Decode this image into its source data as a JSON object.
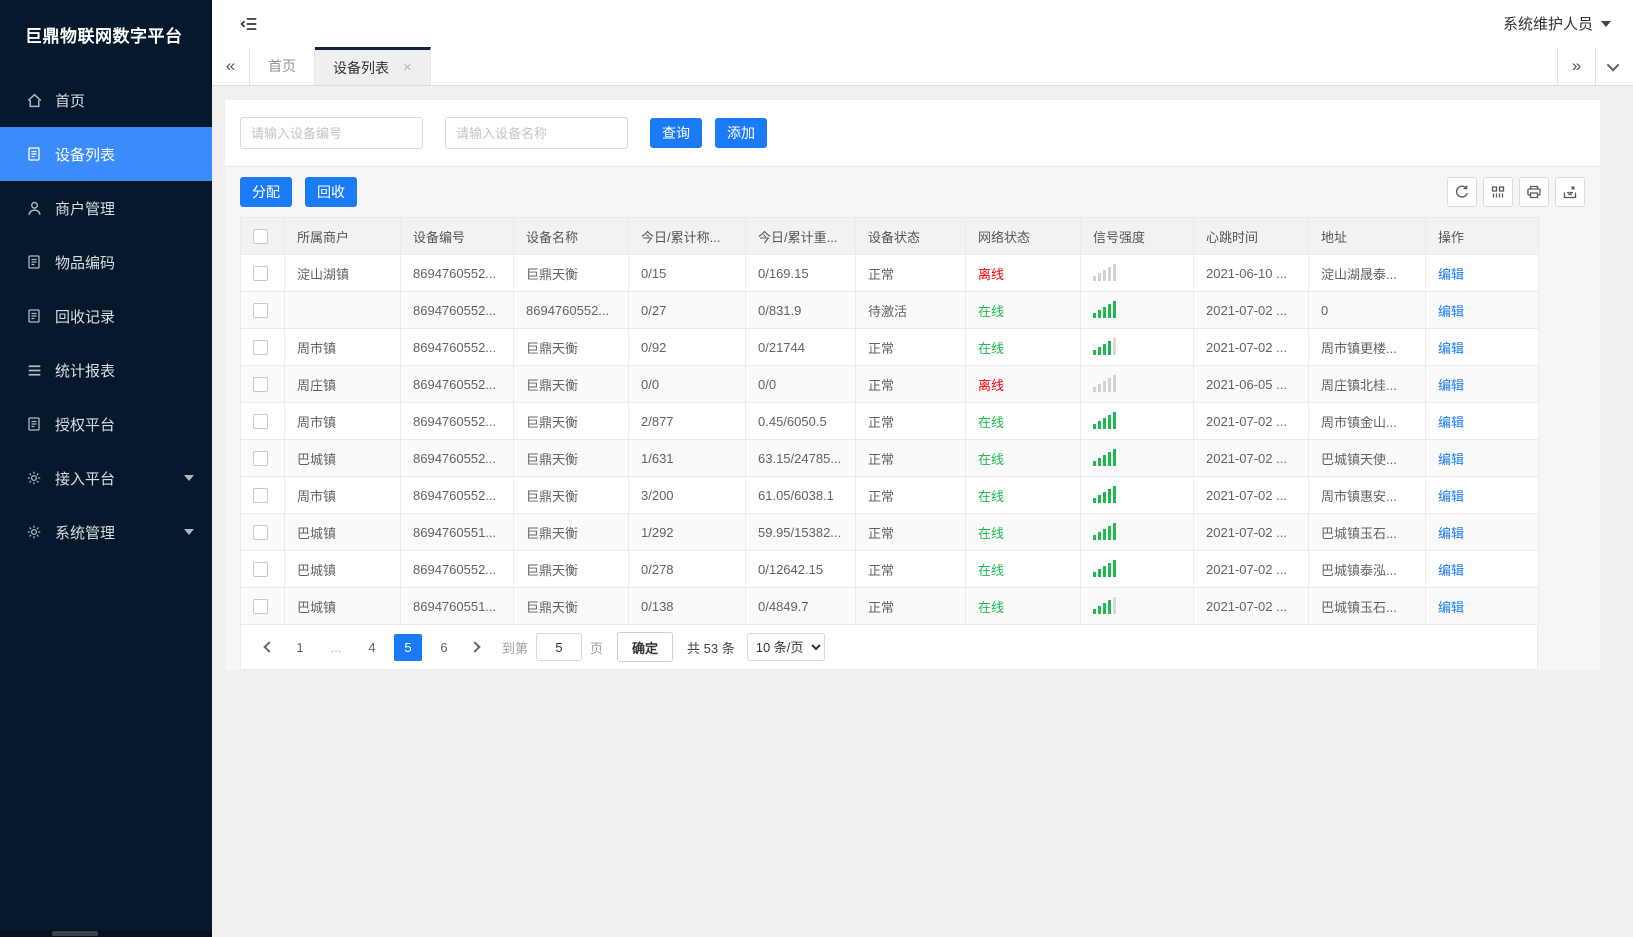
{
  "app": {
    "title": "巨鼎物联网数字平台",
    "user_menu": "系统维护人员"
  },
  "colors": {
    "accent": "#1b7bf7",
    "sidebar_bg": "#06182c",
    "sidebar_active": "#3b8cfa",
    "online_green": "#1cba50",
    "offline_red": "#f40000"
  },
  "sidebar": {
    "items": [
      {
        "label": "首页",
        "icon": "home",
        "active": false,
        "expandable": false
      },
      {
        "label": "设备列表",
        "icon": "doc",
        "active": true,
        "expandable": false
      },
      {
        "label": "商户管理",
        "icon": "user",
        "active": false,
        "expandable": false
      },
      {
        "label": "物品编码",
        "icon": "doc",
        "active": false,
        "expandable": false
      },
      {
        "label": "回收记录",
        "icon": "doc",
        "active": false,
        "expandable": false
      },
      {
        "label": "统计报表",
        "icon": "lines",
        "active": false,
        "expandable": false
      },
      {
        "label": "授权平台",
        "icon": "doc",
        "active": false,
        "expandable": false
      },
      {
        "label": "接入平台",
        "icon": "gear",
        "active": false,
        "expandable": true
      },
      {
        "label": "系统管理",
        "icon": "gear",
        "active": false,
        "expandable": true
      }
    ]
  },
  "tabbar": {
    "tabs": [
      {
        "label": "首页",
        "active": false,
        "closable": false
      },
      {
        "label": "设备列表",
        "active": true,
        "closable": true
      }
    ]
  },
  "search": {
    "device_no_placeholder": "请输入设备编号",
    "device_name_placeholder": "请输入设备名称",
    "query_label": "查询",
    "add_label": "添加"
  },
  "toolbar": {
    "assign_label": "分配",
    "recycle_label": "回收"
  },
  "table": {
    "columns": [
      "所属商户",
      "设备编号",
      "设备名称",
      "今日/累计称...",
      "今日/累计重...",
      "设备状态",
      "网络状态",
      "信号强度",
      "心跳时间",
      "地址",
      "操作"
    ],
    "action_label": "编辑",
    "rows": [
      {
        "merchant": "淀山湖镇",
        "device_no": "8694760552...",
        "device_name": "巨鼎天衡",
        "today_count": "0/15",
        "today_weight": "0/169.15",
        "status": "正常",
        "network": "离线",
        "online": false,
        "signal": 0,
        "heartbeat": "2021-06-10 ...",
        "address": "淀山湖晟泰..."
      },
      {
        "merchant": "",
        "device_no": "8694760552...",
        "device_name": "8694760552...",
        "today_count": "0/27",
        "today_weight": "0/831.9",
        "status": "待激活",
        "network": "在线",
        "online": true,
        "signal": 5,
        "heartbeat": "2021-07-02 ...",
        "address": "0"
      },
      {
        "merchant": "周市镇",
        "device_no": "8694760552...",
        "device_name": "巨鼎天衡",
        "today_count": "0/92",
        "today_weight": "0/21744",
        "status": "正常",
        "network": "在线",
        "online": true,
        "signal": 4,
        "heartbeat": "2021-07-02 ...",
        "address": "周市镇更楼..."
      },
      {
        "merchant": "周庄镇",
        "device_no": "8694760552...",
        "device_name": "巨鼎天衡",
        "today_count": "0/0",
        "today_weight": "0/0",
        "status": "正常",
        "network": "离线",
        "online": false,
        "signal": 0,
        "heartbeat": "2021-06-05 ...",
        "address": "周庄镇北桂..."
      },
      {
        "merchant": "周市镇",
        "device_no": "8694760552...",
        "device_name": "巨鼎天衡",
        "today_count": "2/877",
        "today_weight": "0.45/6050.5",
        "status": "正常",
        "network": "在线",
        "online": true,
        "signal": 5,
        "heartbeat": "2021-07-02 ...",
        "address": "周市镇金山..."
      },
      {
        "merchant": "巴城镇",
        "device_no": "8694760552...",
        "device_name": "巨鼎天衡",
        "today_count": "1/631",
        "today_weight": "63.15/24785...",
        "status": "正常",
        "network": "在线",
        "online": true,
        "signal": 5,
        "heartbeat": "2021-07-02 ...",
        "address": "巴城镇天使..."
      },
      {
        "merchant": "周市镇",
        "device_no": "8694760552...",
        "device_name": "巨鼎天衡",
        "today_count": "3/200",
        "today_weight": "61.05/6038.1",
        "status": "正常",
        "network": "在线",
        "online": true,
        "signal": 5,
        "heartbeat": "2021-07-02 ...",
        "address": "周市镇惠安..."
      },
      {
        "merchant": "巴城镇",
        "device_no": "8694760551...",
        "device_name": "巨鼎天衡",
        "today_count": "1/292",
        "today_weight": "59.95/15382...",
        "status": "正常",
        "network": "在线",
        "online": true,
        "signal": 5,
        "heartbeat": "2021-07-02 ...",
        "address": "巴城镇玉石..."
      },
      {
        "merchant": "巴城镇",
        "device_no": "8694760552...",
        "device_name": "巨鼎天衡",
        "today_count": "0/278",
        "today_weight": "0/12642.15",
        "status": "正常",
        "network": "在线",
        "online": true,
        "signal": 5,
        "heartbeat": "2021-07-02 ...",
        "address": "巴城镇泰泓..."
      },
      {
        "merchant": "巴城镇",
        "device_no": "8694760551...",
        "device_name": "巨鼎天衡",
        "today_count": "0/138",
        "today_weight": "0/4849.7",
        "status": "正常",
        "network": "在线",
        "online": true,
        "signal": 4,
        "heartbeat": "2021-07-02 ...",
        "address": "巴城镇玉石..."
      }
    ]
  },
  "pagination": {
    "pages": [
      "1",
      "...",
      "4",
      "5",
      "6"
    ],
    "active": "5",
    "goto_label": "到第",
    "goto_value": "5",
    "page_unit": "页",
    "confirm_label": "确定",
    "total_label": "共 53 条",
    "page_size": "10 条/页"
  }
}
